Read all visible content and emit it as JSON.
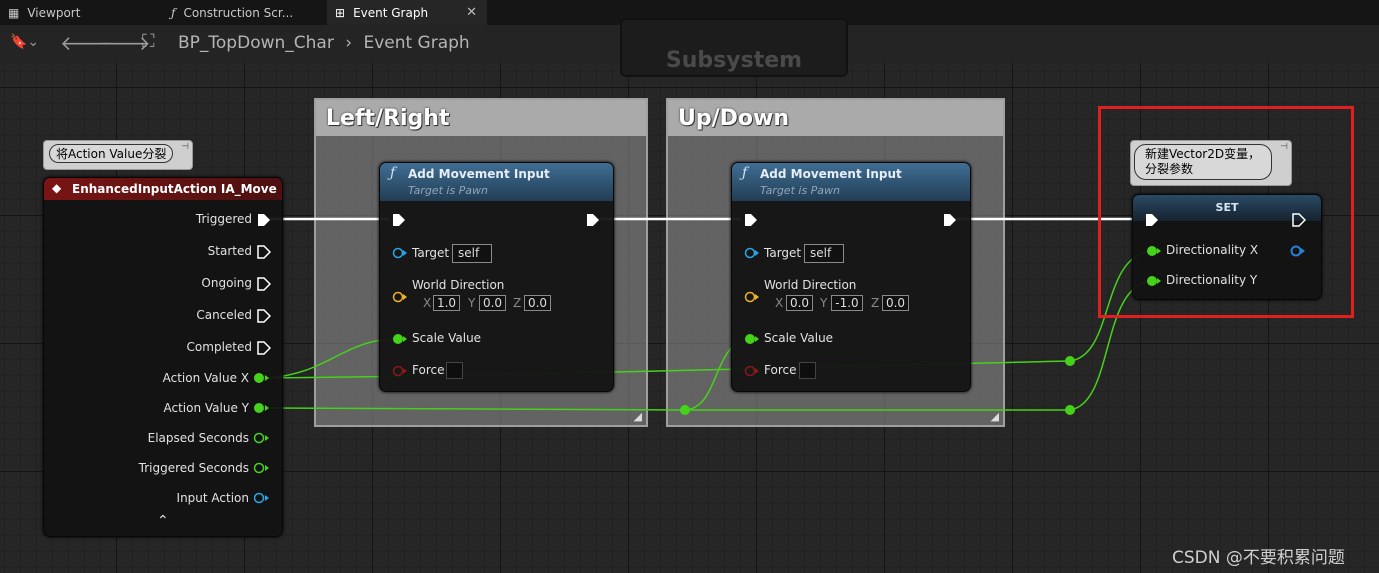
{
  "tabs": [
    {
      "label": "Viewport",
      "icon": "grid-icon"
    },
    {
      "label": "Construction Scr...",
      "icon": "function-icon"
    },
    {
      "label": "Event Graph",
      "icon": "graph-icon",
      "active": true
    }
  ],
  "toolbar": {
    "breadcrumb": [
      "BP_TopDown_Char",
      "Event Graph"
    ]
  },
  "graph": {
    "subsystem_label": "Subsystem",
    "comments": {
      "left_right": "Left/Right",
      "up_down": "Up/Down"
    },
    "event_node": {
      "bubble": "将Action Value分裂",
      "title": "EnhancedInputAction IA_Move",
      "pins": {
        "triggered": "Triggered",
        "started": "Started",
        "ongoing": "Ongoing",
        "canceled": "Canceled",
        "completed": "Completed",
        "action_value_x": "Action Value X",
        "action_value_y": "Action Value Y",
        "elapsed_seconds": "Elapsed Seconds",
        "triggered_seconds": "Triggered Seconds",
        "input_action": "Input Action"
      }
    },
    "add_movement_1": {
      "title": "Add Movement Input",
      "subtitle": "Target is Pawn",
      "target_label": "Target",
      "target_value": "self",
      "world_direction_label": "World Direction",
      "x": "1.0",
      "y": "0.0",
      "z": "0.0",
      "scale_label": "Scale Value",
      "force_label": "Force"
    },
    "add_movement_2": {
      "title": "Add Movement Input",
      "subtitle": "Target is Pawn",
      "target_label": "Target",
      "target_value": "self",
      "world_direction_label": "World Direction",
      "x": "0.0",
      "y": "-1.0",
      "z": "0.0",
      "scale_label": "Scale Value",
      "force_label": "Force"
    },
    "axis_labels": {
      "x": "X",
      "y": "Y",
      "z": "Z"
    },
    "set_node": {
      "bubble_line1": "新建Vector2D变量，",
      "bubble_line2": "分裂参数",
      "title": "SET",
      "pin_x": "Directionality X",
      "pin_y": "Directionality Y"
    }
  },
  "watermark": "CSDN @不要积累问题",
  "colors": {
    "exec": "#ffffff",
    "float": "#46d21a",
    "object": "#2aa6e8",
    "vector": "#f0b41e",
    "bool": "#8a1818",
    "event_header": "#7a1414",
    "function_header": "#2c5d84",
    "highlight": "#e02020"
  }
}
